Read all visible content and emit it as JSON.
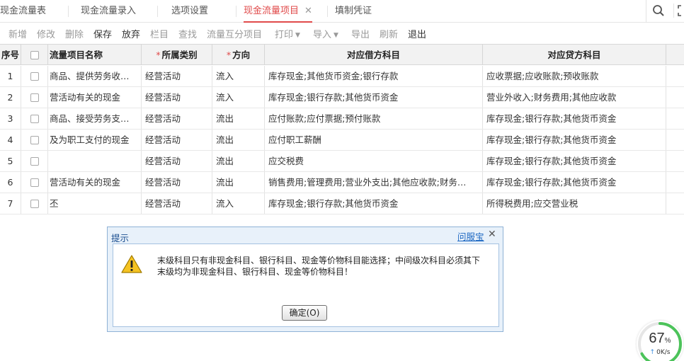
{
  "tabs": [
    {
      "label": "现金流量表",
      "active": false
    },
    {
      "label": "现金流量录入",
      "active": false
    },
    {
      "label": "选项设置",
      "active": false
    },
    {
      "label": "现金流量项目",
      "active": true,
      "close": "✕"
    },
    {
      "label": "填制凭证",
      "active": false
    }
  ],
  "toolbar": {
    "add": "新增",
    "edit": "修改",
    "delete": "删除",
    "save": "保存",
    "discard": "放弃",
    "columns": "栏目",
    "find": "查找",
    "mutual": "流量互分项目",
    "print": "打印",
    "import": "导入",
    "export": "导出",
    "refresh": "刷新",
    "exit": "退出"
  },
  "table": {
    "headers": {
      "seq": "序号",
      "name": "流量项目名称",
      "category": "所属类别",
      "direction": "方向",
      "debit": "对应借方科目",
      "credit": "对应贷方科目",
      "required_mark": "*"
    },
    "rows": [
      {
        "seq": "1",
        "name": "商品、提供劳务收…",
        "category": "经营活动",
        "direction": "流入",
        "debit": "库存现金;其他货币资金;银行存款",
        "credit": "应收票据;应收账款;预收账款"
      },
      {
        "seq": "2",
        "name": "营活动有关的现金",
        "category": "经营活动",
        "direction": "流入",
        "debit": "库存现金;银行存款;其他货币资金",
        "credit": "营业外收入;财务费用;其他应收款"
      },
      {
        "seq": "3",
        "name": "商品、接受劳务支…",
        "category": "经营活动",
        "direction": "流出",
        "debit": "应付账款;应付票据;预付账款",
        "credit": "库存现金;银行存款;其他货币资金"
      },
      {
        "seq": "4",
        "name": "及为职工支付的现金",
        "category": "经营活动",
        "direction": "流出",
        "debit": "应付职工薪酬",
        "credit": "库存现金;银行存款;其他货币资金"
      },
      {
        "seq": "5",
        "name": "",
        "category": "经营活动",
        "direction": "流出",
        "debit": "应交税费",
        "credit": "库存现金;银行存款;其他货币资金"
      },
      {
        "seq": "6",
        "name": "营活动有关的现金",
        "category": "经营活动",
        "direction": "流出",
        "debit": "销售费用;管理费用;营业外支出;其他应收款;财务…",
        "credit": "库存现金;银行存款;其他货币资金"
      },
      {
        "seq": "7",
        "name": "丕",
        "category": "经营活动",
        "direction": "流入",
        "debit": "库存现金;银行存款;其他货币资金",
        "credit": "所得税费用;应交营业税"
      }
    ]
  },
  "dialog": {
    "title": "提示",
    "help_link": "问服宝",
    "close": "✕",
    "message_line1": "末级科目只有非现金科目、银行科目、现金等价物科目能选择；中间级次科目必须其下",
    "message_line2": "末级均为非现金科目、银行科目、现金等价物科目！",
    "ok_label": "确定(O)"
  },
  "speed_widget": {
    "percent": "67",
    "percent_unit": "%",
    "rate": "0K/s",
    "progress": 0.67,
    "ring_color": "#4cc35a"
  },
  "colors": {
    "accent": "#e04a4a",
    "link": "#1a66c2"
  }
}
